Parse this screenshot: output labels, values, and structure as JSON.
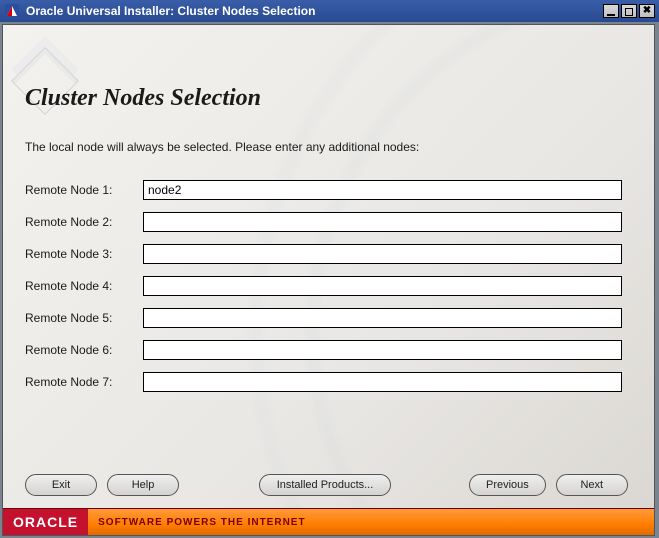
{
  "window": {
    "title": "Oracle Universal Installer: Cluster Nodes Selection"
  },
  "page": {
    "heading": "Cluster Nodes Selection",
    "instruction": "The local node will always be selected.  Please enter any additional nodes:"
  },
  "nodes": [
    {
      "label": "Remote Node 1:",
      "value": "node2"
    },
    {
      "label": "Remote Node 2:",
      "value": ""
    },
    {
      "label": "Remote Node 3:",
      "value": ""
    },
    {
      "label": "Remote Node 4:",
      "value": ""
    },
    {
      "label": "Remote Node 5:",
      "value": ""
    },
    {
      "label": "Remote Node 6:",
      "value": ""
    },
    {
      "label": "Remote Node 7:",
      "value": ""
    }
  ],
  "buttons": {
    "exit": "Exit",
    "help": "Help",
    "installed": "Installed Products...",
    "previous": "Previous",
    "next": "Next"
  },
  "footer": {
    "brand": "ORACLE",
    "tagline": "SOFTWARE POWERS THE INTERNET"
  }
}
